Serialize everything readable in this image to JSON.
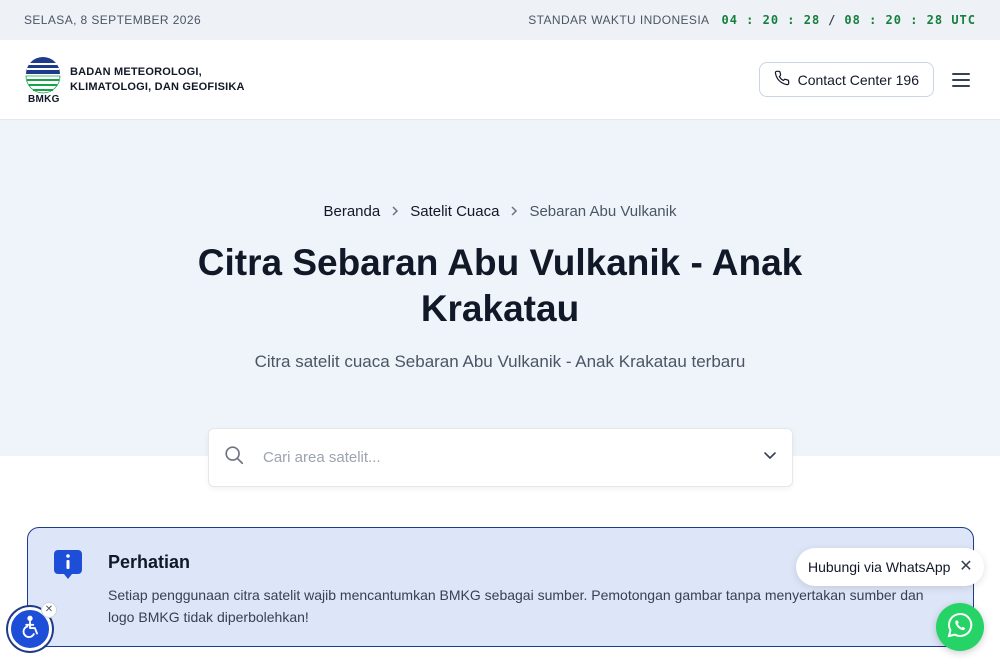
{
  "topbar": {
    "date": "SELASA, 8 SEPTEMBER 2026",
    "timezone_label": "STANDAR WAKTU INDONESIA",
    "local_time": "04 : 20 : 28",
    "separator": "/",
    "utc_time": "08 : 20 : 28 UTC"
  },
  "header": {
    "logo_text": "BMKG",
    "org_name_line1": "BADAN METEOROLOGI,",
    "org_name_line2": "KLIMATOLOGI, DAN GEOFISIKA",
    "contact_label": "Contact Center 196"
  },
  "breadcrumb": {
    "items": [
      "Beranda",
      "Satelit Cuaca",
      "Sebaran Abu Vulkanik"
    ],
    "separator": ">"
  },
  "hero": {
    "title": "Citra Sebaran Abu Vulkanik - Anak Krakatau",
    "subtitle": "Citra satelit cuaca Sebaran Abu Vulkanik - Anak Krakatau terbaru"
  },
  "search": {
    "placeholder": "Cari area satelit...",
    "value": ""
  },
  "notice": {
    "title": "Perhatian",
    "text": "Setiap penggunaan citra satelit wajib mencantumkan BMKG sebagai sumber. Pemotongan gambar tanpa menyertakan sumber dan logo BMKG tidak diperbolehkan!"
  },
  "whatsapp": {
    "label": "Hubungi via WhatsApp"
  },
  "colors": {
    "accent": "#1e3a8a",
    "clock": "#15803d",
    "hero_bg": "#eff4fa",
    "notice_bg": "#dde6f8",
    "whatsapp": "#25d366"
  },
  "icons": {
    "phone": "phone-icon",
    "menu": "hamburger-menu-icon",
    "search": "search-icon",
    "dropdown": "chevron-down-icon",
    "notice": "info-chat-icon",
    "accessibility": "accessibility-icon",
    "whatsapp": "whatsapp-icon",
    "close": "close-icon"
  }
}
